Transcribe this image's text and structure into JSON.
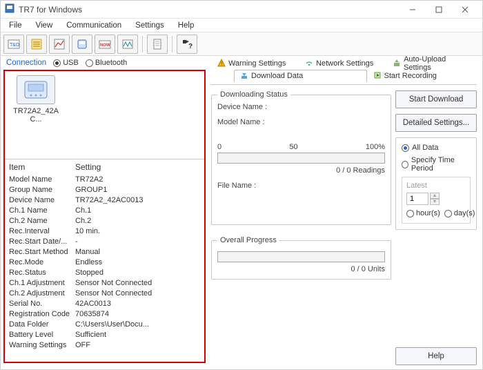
{
  "window": {
    "title": "TR7 for Windows"
  },
  "menu": [
    "File",
    "View",
    "Communication",
    "Settings",
    "Help"
  ],
  "toolbar": {
    "icons": [
      "toolbar-app-icon",
      "toolbar-list-icon",
      "toolbar-chart-icon",
      "toolbar-device-icon",
      "toolbar-now-icon",
      "toolbar-zigzag-icon",
      "toolbar-doc-icon",
      "toolbar-help-icon"
    ]
  },
  "connection": {
    "label": "Connection",
    "usb": "USB",
    "bluetooth": "Bluetooth",
    "selected": "usb"
  },
  "device": {
    "label": "TR72A2_42AC..."
  },
  "props": {
    "hdr_item": "Item",
    "hdr_setting": "Setting",
    "rows": [
      {
        "item": "Model Name",
        "setting": "TR72A2"
      },
      {
        "item": "Group Name",
        "setting": "GROUP1"
      },
      {
        "item": "Device Name",
        "setting": "TR72A2_42AC0013"
      },
      {
        "item": "Ch.1 Name",
        "setting": "Ch.1"
      },
      {
        "item": "Ch.2 Name",
        "setting": "Ch.2"
      },
      {
        "item": "Rec.Interval",
        "setting": "10 min."
      },
      {
        "item": "Rec.Start Date/...",
        "setting": "-"
      },
      {
        "item": "Rec.Start Method",
        "setting": "Manual"
      },
      {
        "item": "Rec.Mode",
        "setting": "Endless"
      },
      {
        "item": "Rec.Status",
        "setting": "Stopped"
      },
      {
        "item": "Ch.1 Adjustment",
        "setting": "Sensor Not Connected"
      },
      {
        "item": "Ch.2 Adjustment",
        "setting": "Sensor Not Connected"
      },
      {
        "item": "Serial No.",
        "setting": "42AC0013"
      },
      {
        "item": "Registration Code",
        "setting": "70635874"
      },
      {
        "item": "Data Folder",
        "setting": "C:\\Users\\User\\Docu..."
      },
      {
        "item": "Battery Level",
        "setting": "Sufficient"
      },
      {
        "item": "Warning Settings",
        "setting": "OFF"
      }
    ]
  },
  "tabs": {
    "warning": "Warning Settings",
    "network": "Network Settings",
    "auto_upload": "Auto-Upload Settings",
    "download": "Download Data",
    "start_rec": "Start Recording"
  },
  "downloading": {
    "legend": "Downloading Status",
    "device_name": "Device Name :",
    "model_name": "Model Name :",
    "ticks": {
      "t0": "0",
      "t50": "50",
      "t100": "100%"
    },
    "readings": "0 / 0 Readings",
    "file_name": "File Name :"
  },
  "overall": {
    "legend": "Overall Progress",
    "units": "0 / 0 Units"
  },
  "sidebtn": {
    "start": "Start Download",
    "detailed": "Detailed Settings...",
    "help": "Help"
  },
  "range": {
    "all": "All Data",
    "specify": "Specify Time Period",
    "latest": "Latest",
    "value": "1",
    "hours": "hour(s)",
    "days": "day(s)"
  }
}
